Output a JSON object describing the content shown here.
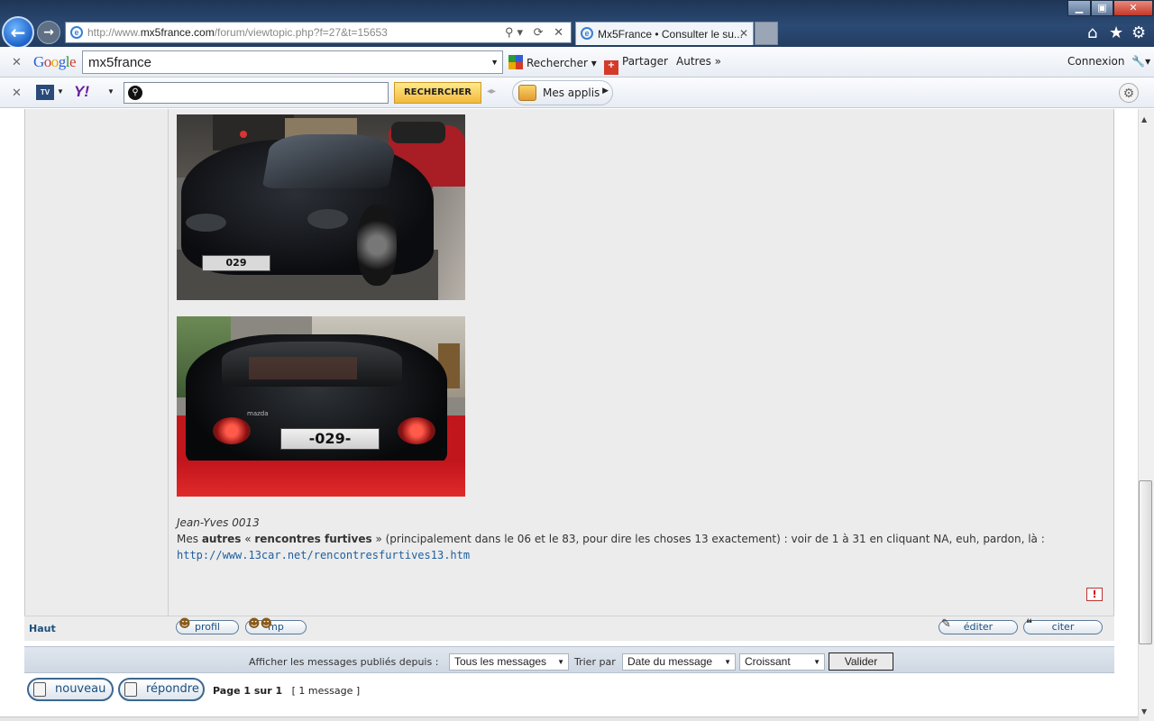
{
  "browser": {
    "url_prefix": "http://www.",
    "url_domain": "mx5france.com",
    "url_path": "/forum/viewtopic.php?f=27&t=15653",
    "tab_title": "Mx5France • Consulter le su...",
    "address_tools": "⚲▾ ⟳ ✕"
  },
  "google_toolbar": {
    "logo": "Google",
    "search_value": "mx5france",
    "rechercher": "Rechercher",
    "partager": "Partager",
    "autres": "Autres",
    "connexion": "Connexion"
  },
  "yahoo_toolbar": {
    "tv_label": "TV",
    "logo": "Y!",
    "search_button": "RECHERCHER",
    "mes_applis": "Mes applis"
  },
  "post": {
    "signature_name": "Jean-Yves 0013",
    "line_mes": "Mes ",
    "line_autres": "autres",
    "line_quote_open": " « ",
    "line_bold": "rencontres furtives",
    "line_rest": " » (principalement dans le 06 et le 83, pour dire les choses 13 exactement) : voir de 1 à 31 en cliquant NA, euh, pardon, là :",
    "link": "http://www.13car.net/rencontresfurtives13.htm",
    "report_icon": "!",
    "plate1": "029",
    "plate2": "-029-",
    "brand": "mazda"
  },
  "post_actions": {
    "haut": "Haut",
    "profil": "profil",
    "mp": "mp",
    "editer": "éditer",
    "citer": "citer"
  },
  "sort_bar": {
    "afficher_label": "Afficher les messages publiés depuis :",
    "afficher_value": "Tous les messages",
    "trier_label": "Trier par",
    "trier_value": "Date du message",
    "order_value": "Croissant",
    "valider": "Valider"
  },
  "footer": {
    "nouveau": "nouveau",
    "repondre": "répondre",
    "page_info": "Page 1 sur 1",
    "message_count": "[ 1 message ]"
  }
}
